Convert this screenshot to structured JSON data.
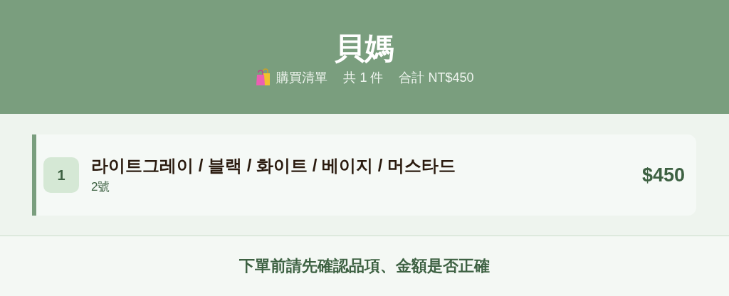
{
  "header": {
    "title": "貝媽",
    "subtitle": [
      "購買清單",
      "共 1 件",
      "合計 NT$450"
    ]
  },
  "items": [
    {
      "index": "1",
      "name": "라이트그레이 / 블랙 / 화이트 / 베이지 / 머스타드",
      "size": "2號",
      "price": "$450"
    }
  ],
  "footer": {
    "note": "下單前請先確認品項、金額是否正確"
  }
}
